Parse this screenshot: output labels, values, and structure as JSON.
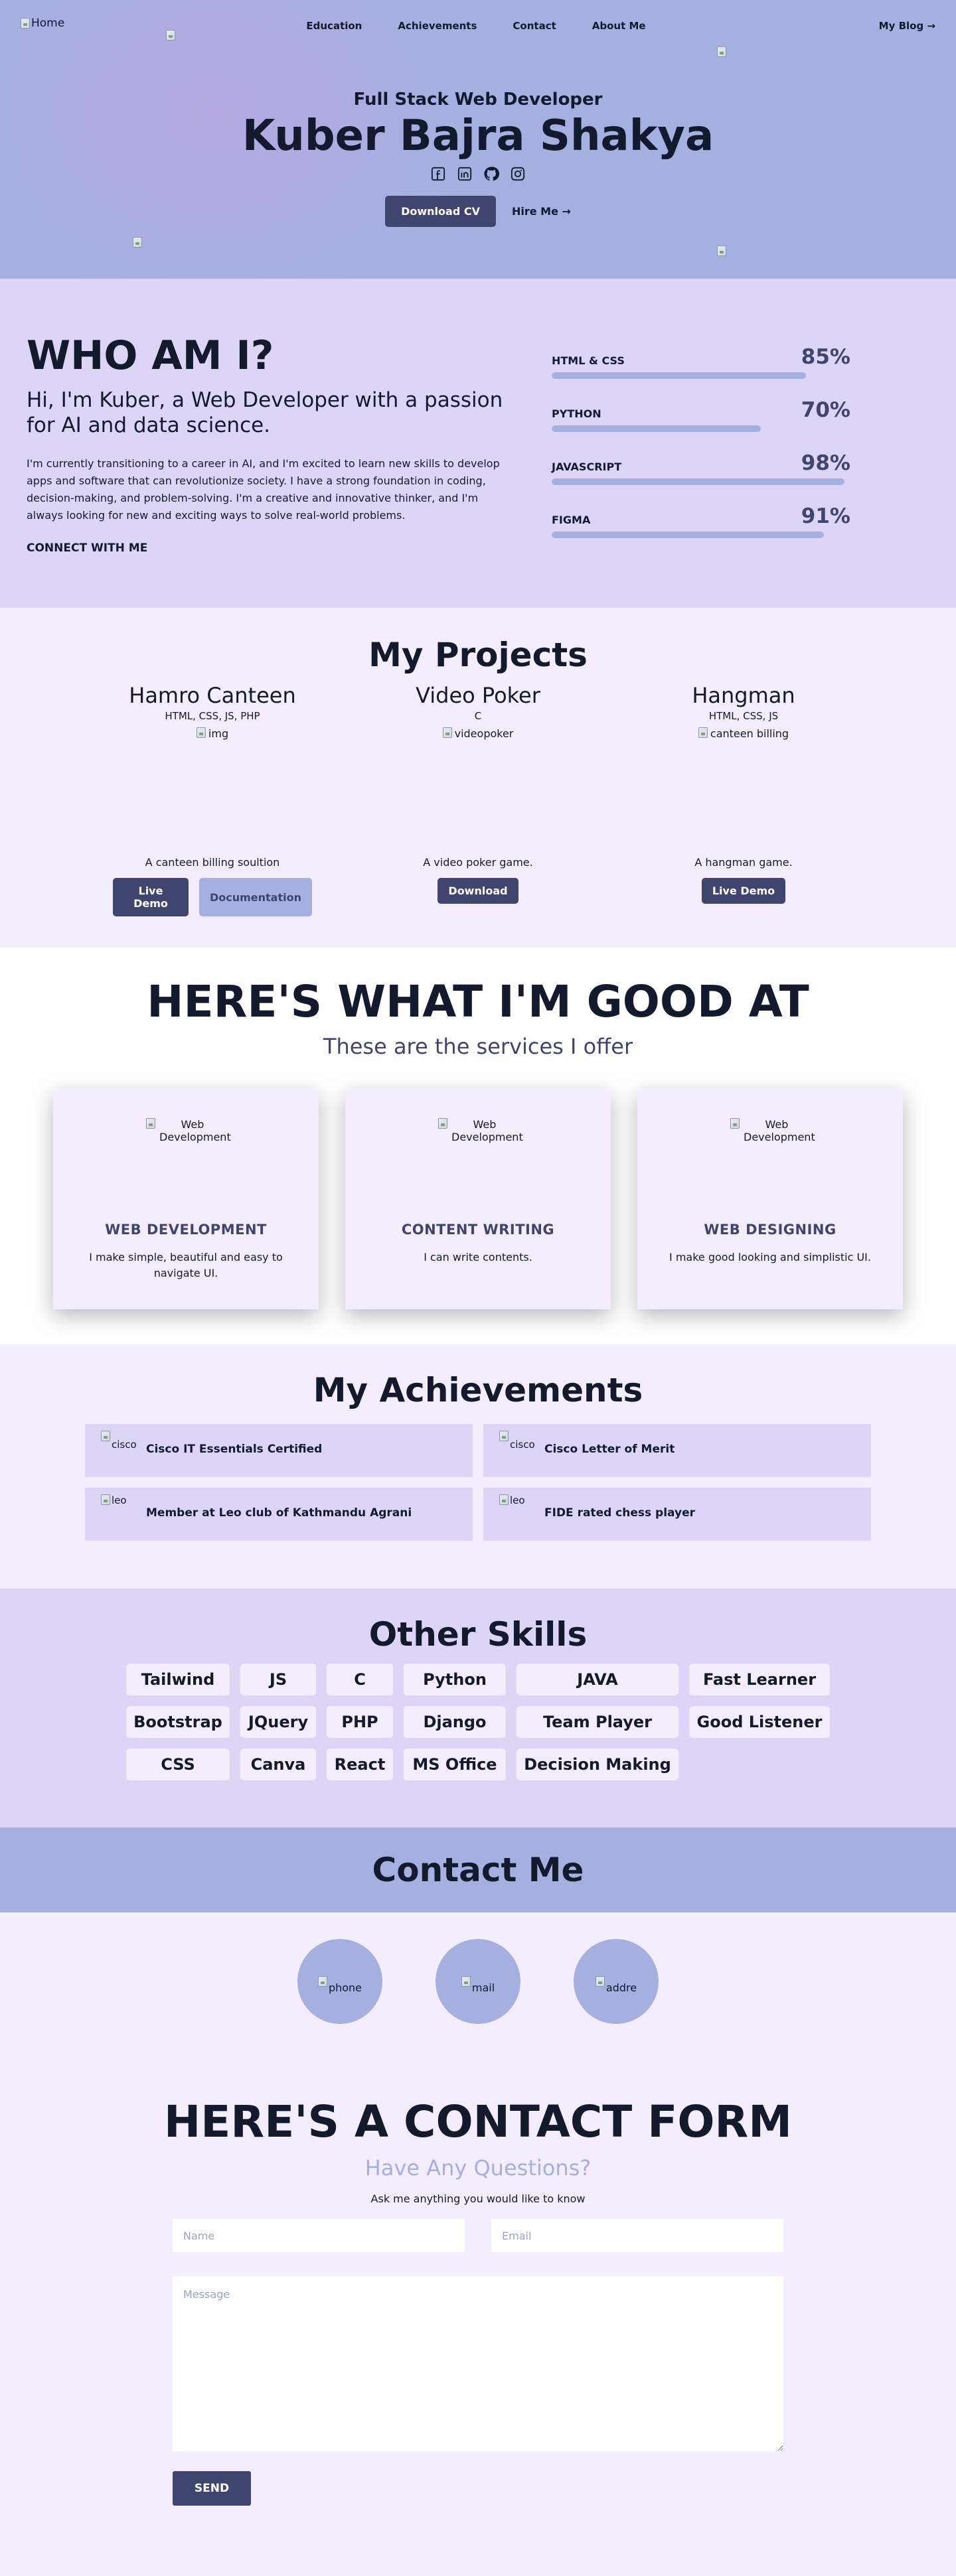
{
  "nav": {
    "home_label": "Home",
    "links": [
      "Education",
      "Achievements",
      "Contact",
      "About Me"
    ],
    "blog_label": "My Blog →"
  },
  "hero": {
    "subtitle": "Full Stack Web Developer",
    "name": "Kuber Bajra Shakya",
    "socials": [
      "facebook-icon",
      "linkedin-icon",
      "github-icon",
      "instagram-icon"
    ],
    "download_label": "Download CV",
    "hire_label": "Hire Me →"
  },
  "about": {
    "title": "WHO AM I?",
    "lead": "Hi, I'm Kuber, a Web Developer with a passion for AI and data science.",
    "body": "I'm currently transitioning to a career in AI, and I'm excited to learn new skills to develop apps and software that can revolutionize society. I have a strong foundation in coding, decision-making, and problem-solving. I'm a creative and innovative thinker, and I'm always looking for new and exciting ways to solve real-world problems.",
    "connect": "CONNECT WITH ME",
    "skills": [
      {
        "name": "HTML & CSS",
        "percent": "85%",
        "level": 0.85
      },
      {
        "name": "PYTHON",
        "percent": "70%",
        "level": 0.7
      },
      {
        "name": "JAVASCRIPT",
        "percent": "98%",
        "level": 0.98
      },
      {
        "name": "FIGMA",
        "percent": "91%",
        "level": 0.91
      }
    ]
  },
  "projects": {
    "title": "My Projects",
    "items": [
      {
        "name": "Hamro Canteen",
        "tech": "HTML, CSS, JS, PHP",
        "img_alt": "img",
        "desc": "A canteen billing soultion",
        "buttons": [
          "Live Demo",
          "Documentation"
        ]
      },
      {
        "name": "Video Poker",
        "tech": "C",
        "img_alt": "videopoker",
        "desc": "A video poker game.",
        "buttons": [
          "Download"
        ]
      },
      {
        "name": "Hangman",
        "tech": "HTML, CSS, JS",
        "img_alt": "canteen billing",
        "desc": "A hangman game.",
        "buttons": [
          "Live Demo"
        ]
      }
    ]
  },
  "services": {
    "title": "HERE'S WHAT I'M GOOD AT",
    "subtitle": "These are the services I offer",
    "items": [
      {
        "img_alt": "Web Development",
        "title": "WEB DEVELOPMENT",
        "text": "I make simple, beautiful and easy to navigate UI."
      },
      {
        "img_alt": "Web Development",
        "title": "CONTENT WRITING",
        "text": "I can write contents."
      },
      {
        "img_alt": "Web Development",
        "title": "WEB DESIGNING",
        "text": "I make good looking and simplistic UI."
      }
    ]
  },
  "achievements": {
    "title": "My Achievements",
    "items": [
      {
        "icon_alt": "cisco",
        "text": "Cisco IT Essentials Certified"
      },
      {
        "icon_alt": "cisco",
        "text": "Cisco Letter of Merit"
      },
      {
        "icon_alt": "leo",
        "text": "Member at Leo club of Kathmandu Agrani"
      },
      {
        "icon_alt": "leo",
        "text": "FIDE rated chess player"
      }
    ]
  },
  "other_skills": {
    "title": "Other Skills",
    "chips": [
      "Tailwind",
      "JS",
      "C",
      "Python",
      "JAVA",
      "Fast Learner",
      "Bootstrap",
      "JQuery",
      "PHP",
      "Django",
      "Team Player",
      "Good Listener",
      "CSS",
      "Canva",
      "React",
      "MS Office",
      "Decision Making"
    ]
  },
  "contact": {
    "title": "Contact Me",
    "icons": [
      "phone",
      "mail",
      "addre"
    ]
  },
  "form": {
    "title": "HERE'S A CONTACT FORM",
    "subtitle": "Have Any Questions?",
    "hint": "Ask me anything you would like to know",
    "name_placeholder": "Name",
    "email_placeholder": "Email",
    "message_placeholder": "Message",
    "send_label": "SEND"
  },
  "colors": {
    "primary": "#404570",
    "accent": "#a5b0e1",
    "lavender": "#dcd5f6",
    "background": "#f3edfd"
  }
}
